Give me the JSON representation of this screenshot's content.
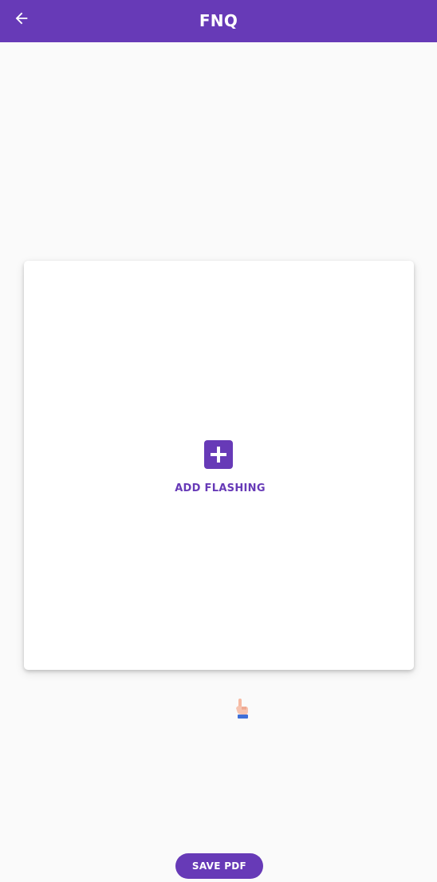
{
  "appbar": {
    "title": "FNQ",
    "back_icon": "arrow-left-icon",
    "color": "#673ab7"
  },
  "card": {
    "add_icon": "plus-square-icon",
    "add_label": "ADD FLASHING"
  },
  "hint": {
    "icon": "tap-hand-icon"
  },
  "footer": {
    "save_label": "SAVE PDF"
  }
}
